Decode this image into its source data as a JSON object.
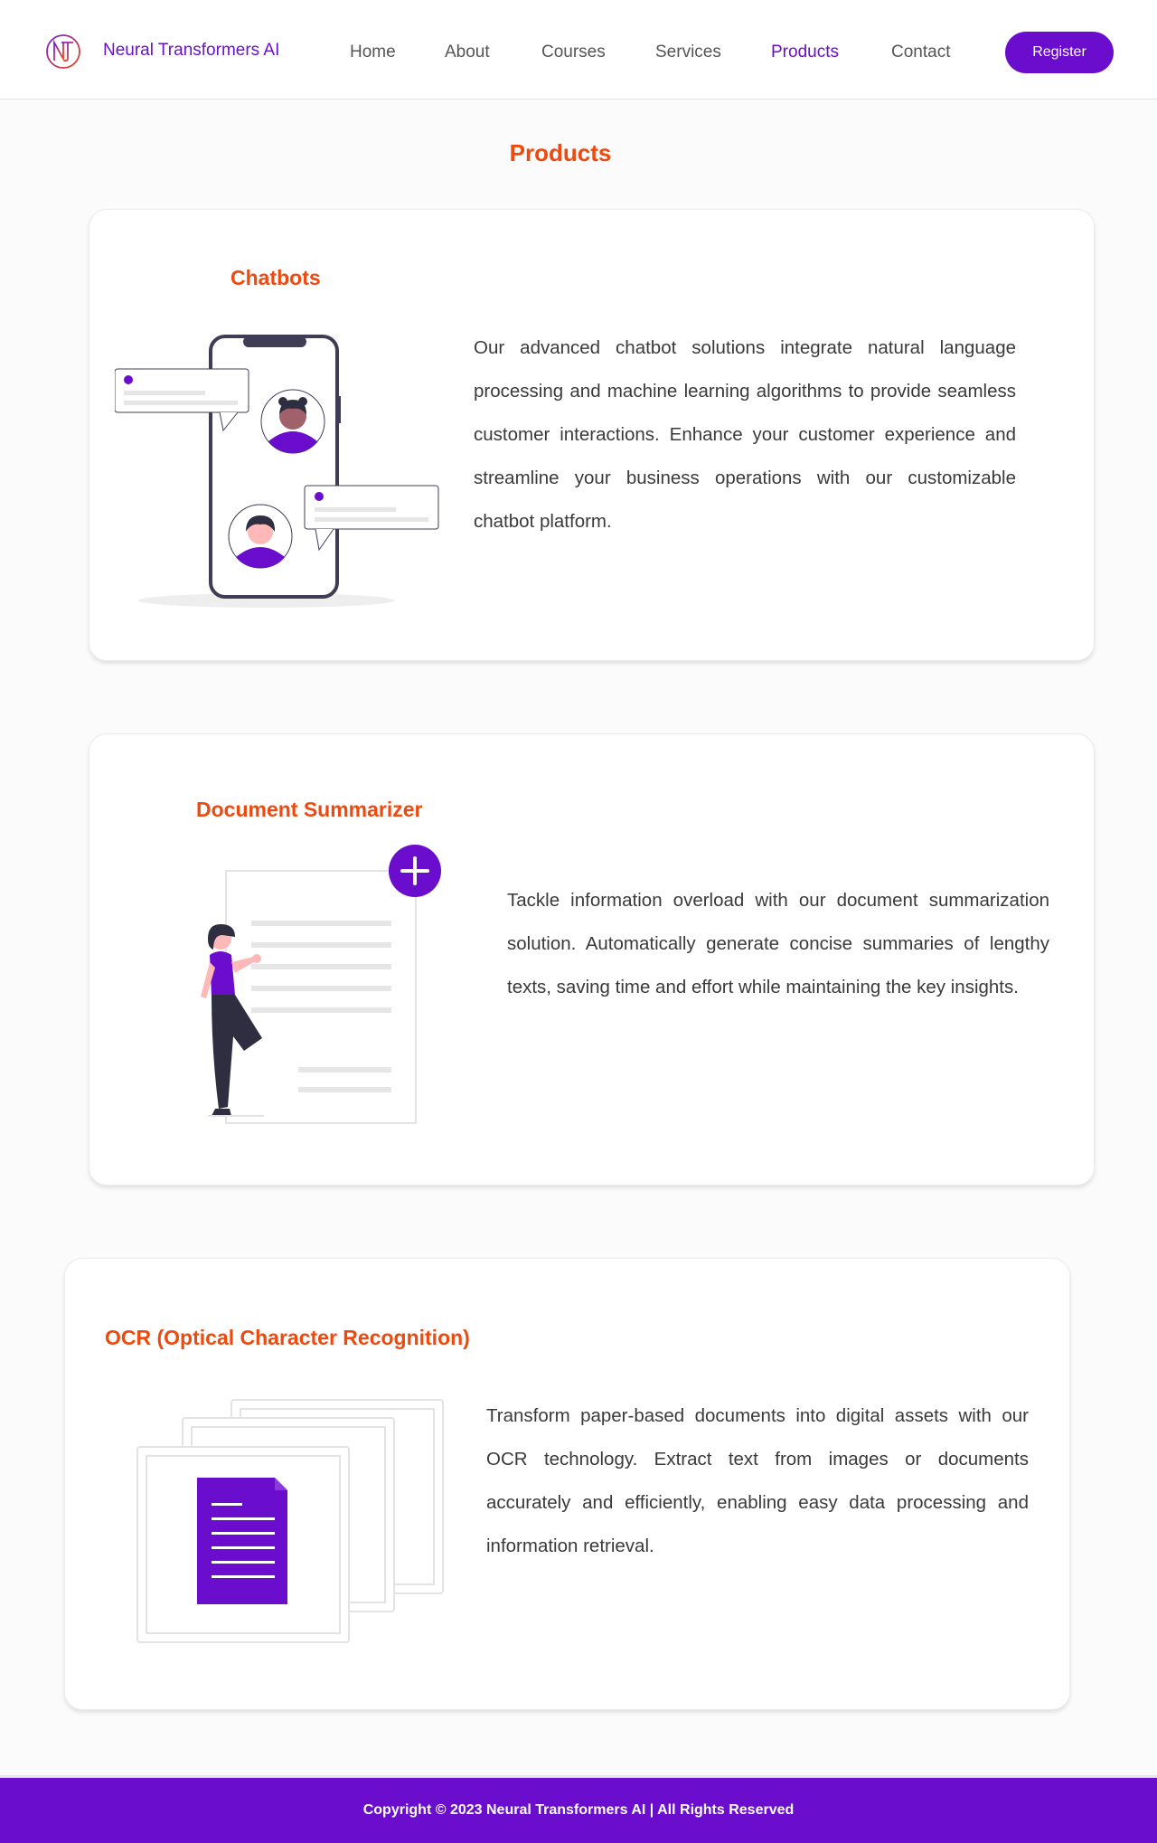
{
  "header": {
    "brand": "Neural Transformers AI",
    "nav": [
      "Home",
      "About",
      "Courses",
      "Services",
      "Products",
      "Contact"
    ],
    "active_nav": "Products",
    "register_label": "Register"
  },
  "colors": {
    "accent_purple": "#6a0dcc",
    "title_orange": "#ee4a10"
  },
  "main": {
    "title": "Products",
    "products": [
      {
        "title": "Chatbots",
        "description": "Our advanced chatbot solutions integrate natural language processing and machine learning algorithms to provide seamless customer interactions. Enhance your customer experience and streamline your business operations with our customizable chatbot platform.",
        "icon": "chatbot-phone-illustration"
      },
      {
        "title": "Document Summarizer",
        "description": "Tackle information overload with our document summarization solution. Automatically generate concise summaries of lengthy texts, saving time and effort while maintaining the key insights.",
        "icon": "document-summarizer-illustration"
      },
      {
        "title": "OCR (Optical Character Recognition)",
        "description": "Transform paper-based documents into digital assets with our OCR technology. Extract text from images or documents accurately and efficiently, enabling easy data processing and information retrieval.",
        "icon": "ocr-documents-illustration"
      }
    ]
  },
  "footer": {
    "copyright": "Copyright © 2023 Neural Transformers AI | All Rights Reserved"
  }
}
